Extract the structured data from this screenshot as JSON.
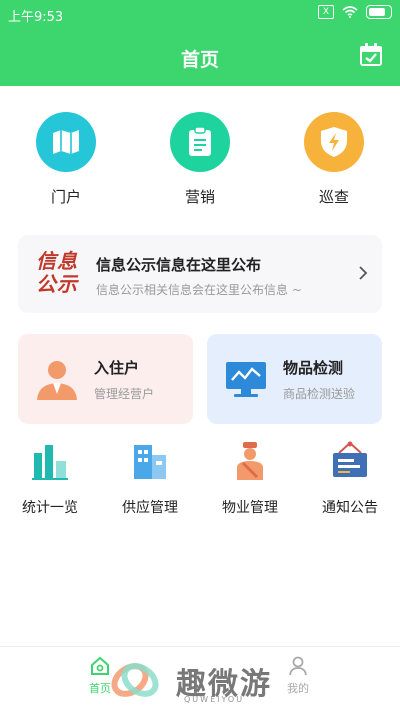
{
  "status_bar": {
    "time": "上午9:53",
    "sim_label": "X"
  },
  "header": {
    "title": "首页"
  },
  "quick_actions": [
    {
      "label": "门户",
      "icon": "map-icon",
      "color": "#25c6d8"
    },
    {
      "label": "营销",
      "icon": "clipboard-icon",
      "color": "#1fd39e"
    },
    {
      "label": "巡查",
      "icon": "shield-icon",
      "color": "#f7b23b"
    }
  ],
  "notice": {
    "logo_line1": "信息",
    "logo_line2": "公示",
    "title": "信息公示信息在这里公布",
    "subtitle": "信息公示相关信息会在这里公布信息 ~"
  },
  "cards": [
    {
      "title": "入住户",
      "subtitle": "管理经营户"
    },
    {
      "title": "物品检测",
      "subtitle": "商品检测送验"
    }
  ],
  "grid": [
    {
      "label": "统计一览",
      "icon": "bar-chart-icon"
    },
    {
      "label": "供应管理",
      "icon": "building-icon"
    },
    {
      "label": "物业管理",
      "icon": "staff-icon"
    },
    {
      "label": "通知公告",
      "icon": "notice-board-icon"
    }
  ],
  "tabs": [
    {
      "label": "首页",
      "active": true
    },
    {
      "label": "我的",
      "active": false
    }
  ],
  "watermark": {
    "text": "趣微游",
    "sub": "QUWEIYOU"
  },
  "colors": {
    "primary": "#3dd56d"
  }
}
